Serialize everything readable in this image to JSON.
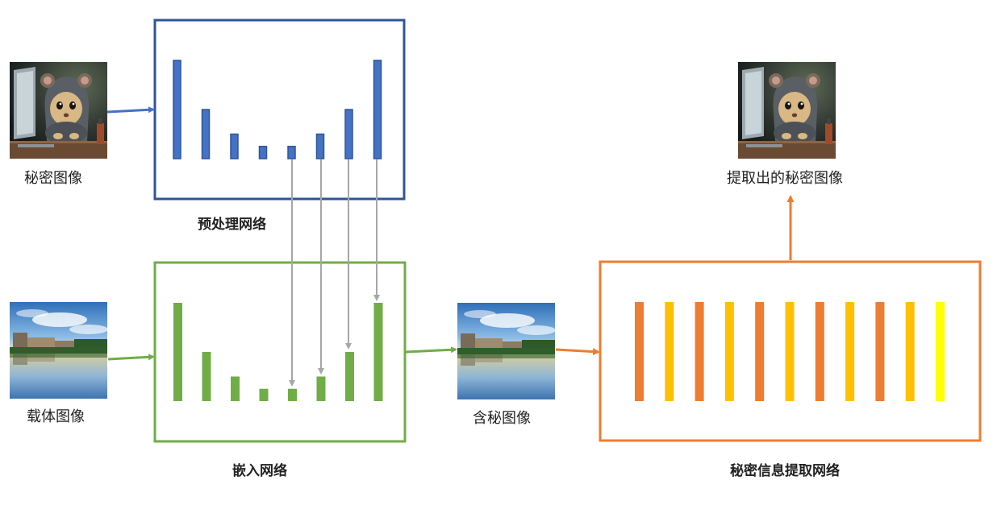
{
  "labels": {
    "secret_image": "秘密图像",
    "carrier_image": "载体图像",
    "stego_image": "含秘图像",
    "extracted_secret_image": "提取出的秘密图像",
    "preprocess_network": "预处理网络",
    "embedding_network": "嵌入网络",
    "extraction_network": "秘密信息提取网络"
  },
  "bars": {
    "preprocess_levels": [
      1.0,
      0.5,
      0.25,
      0.125,
      0.125,
      0.25,
      0.5,
      1.0
    ],
    "embedding_levels": [
      1.0,
      0.5,
      0.25,
      0.125,
      0.125,
      0.25,
      0.5,
      1.0
    ],
    "extraction_colors": [
      "#ED7D31",
      "#FFC000",
      "#ED7D31",
      "#FFC000",
      "#ED7D31",
      "#FFC000",
      "#ED7D31",
      "#FFC000",
      "#ED7D31",
      "#FFC000",
      "#FFFF00"
    ]
  },
  "images": {
    "secret": "hooded-mouse-at-computer",
    "carrier": "campus-lake-landscape",
    "stego": "campus-lake-landscape",
    "extracted": "hooded-mouse-at-computer"
  },
  "colors": {
    "preprocess": "#2F5597",
    "preprocess_bar": "#4472C4",
    "embedding": "#70AD47",
    "extraction": "#ED7D31",
    "connector": "#A6A6A6"
  }
}
